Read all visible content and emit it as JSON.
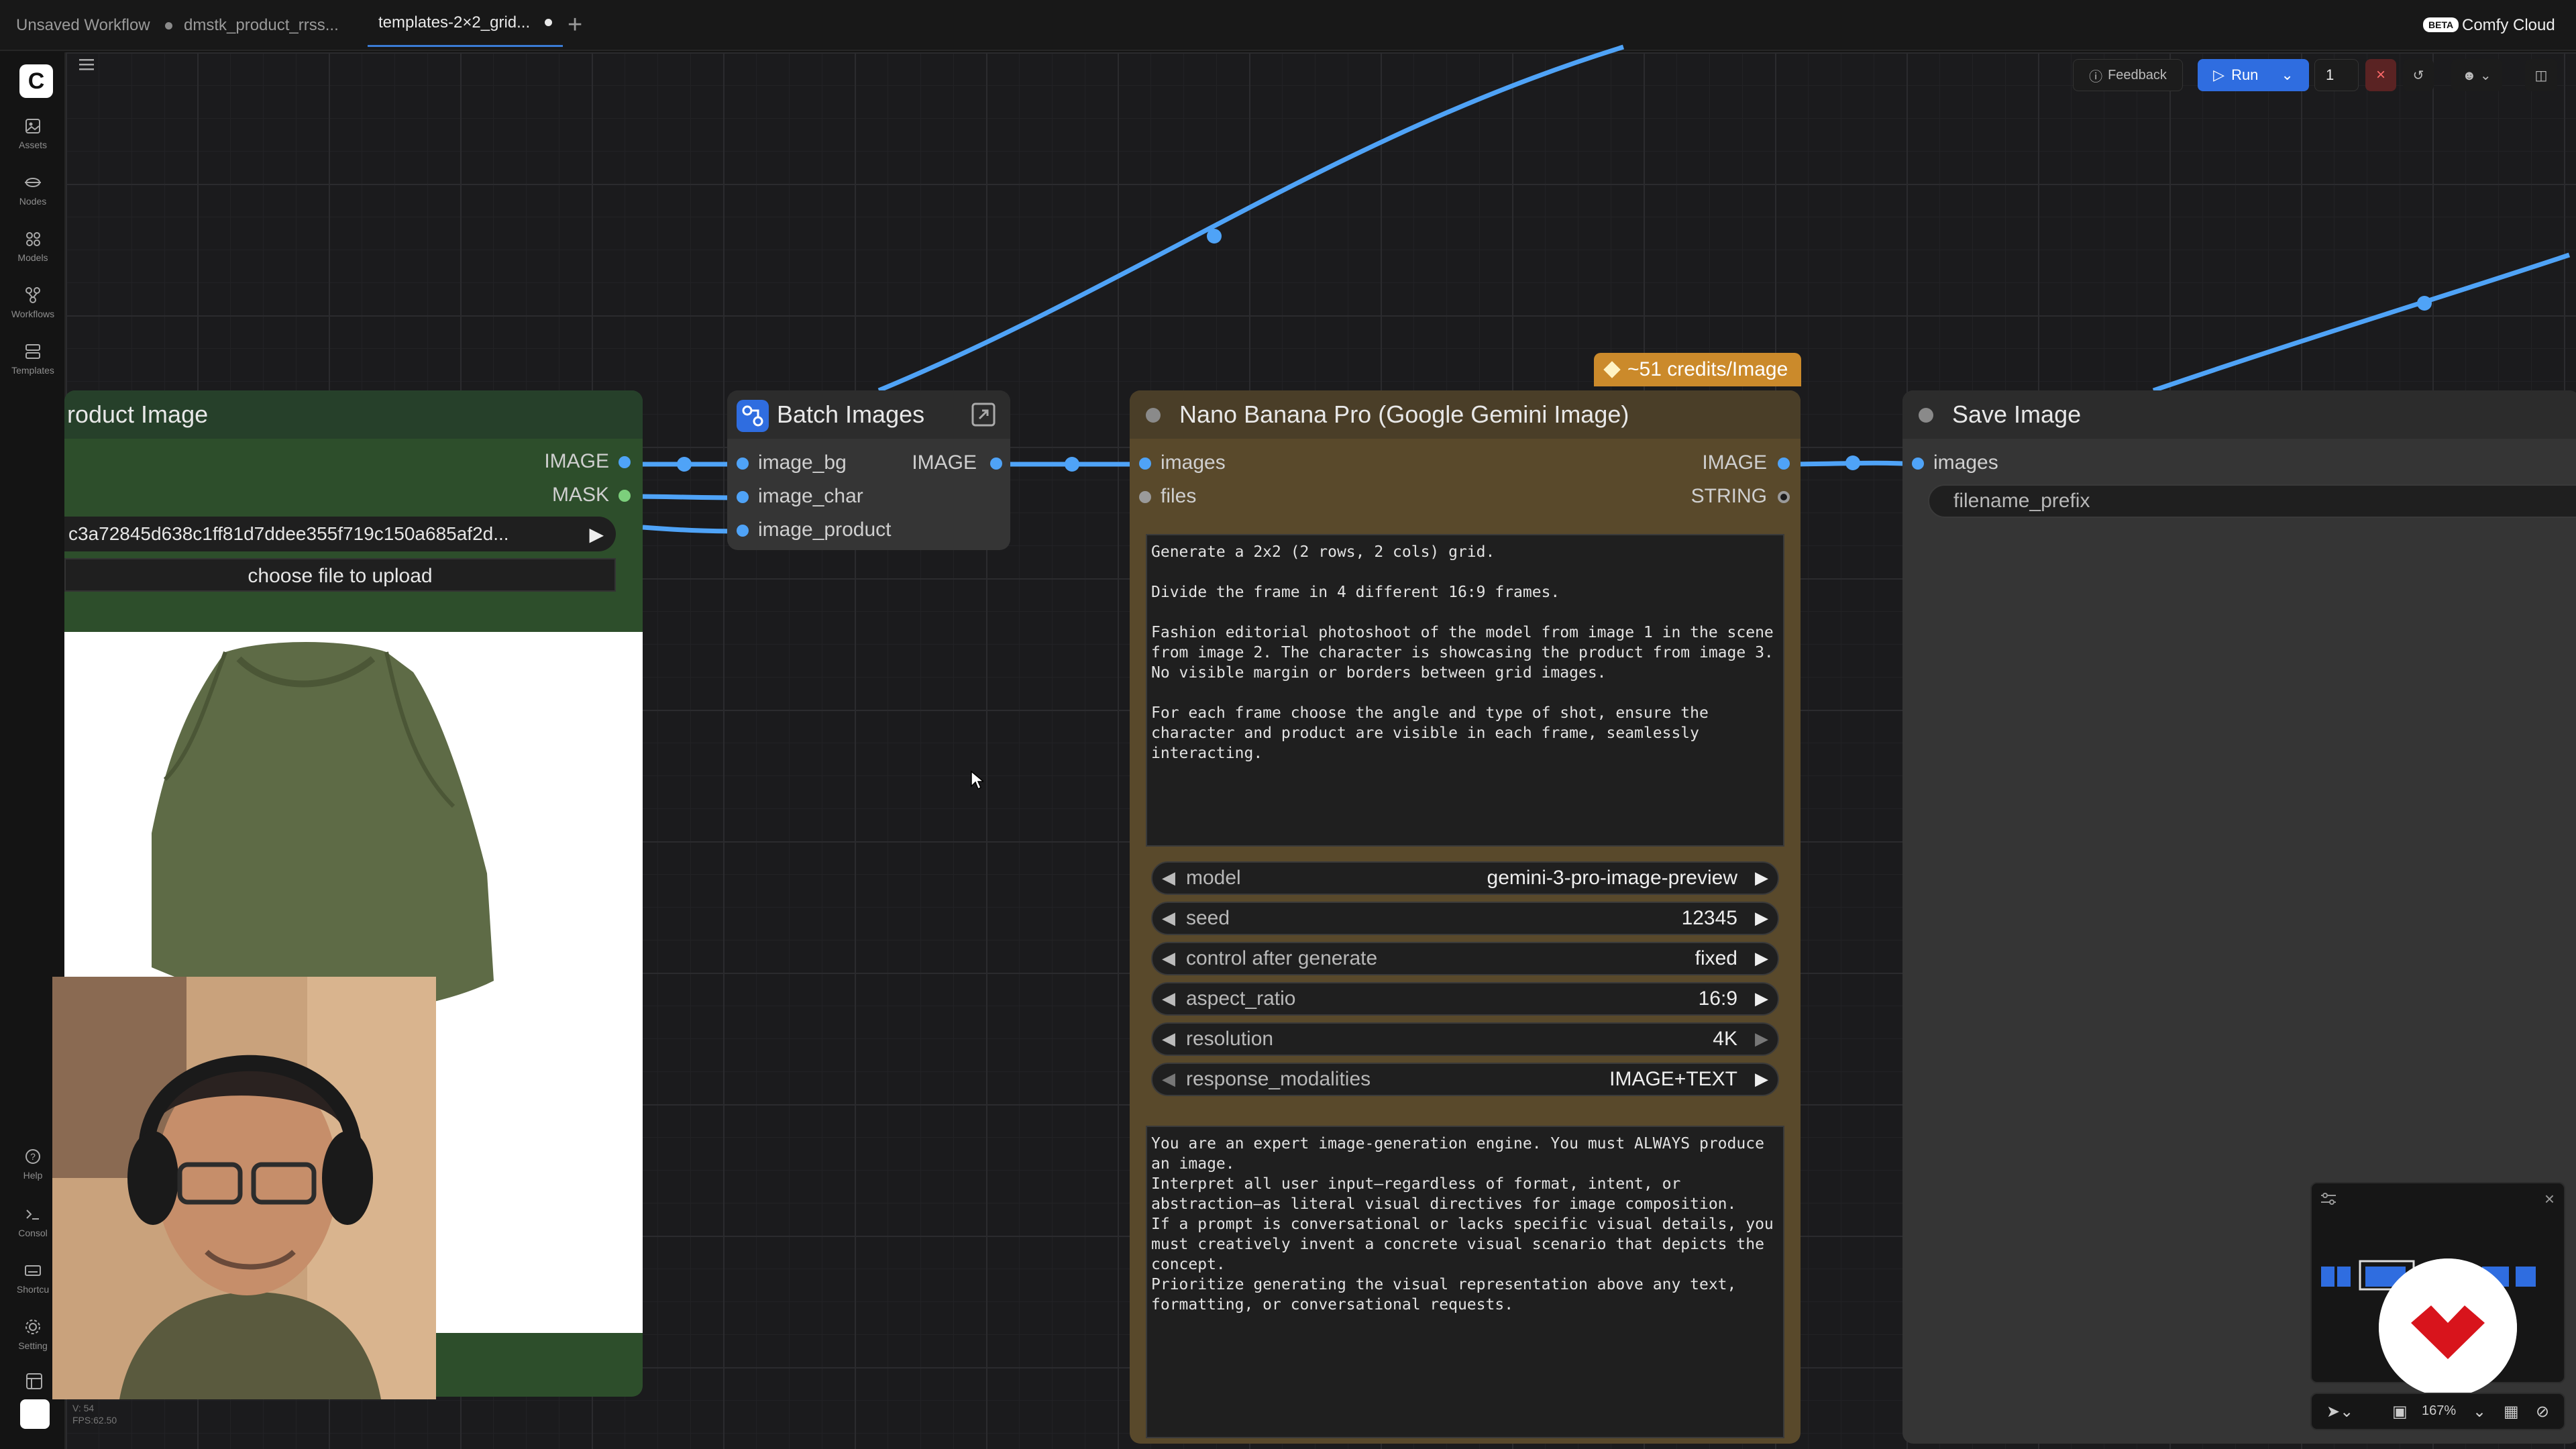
{
  "tabs": [
    {
      "label": "Unsaved Workflow",
      "modified": true,
      "active": false
    },
    {
      "label": "dmstk_product_rrss...",
      "modified": false,
      "active": false
    },
    {
      "label": "templates-2×2_grid...",
      "modified": true,
      "active": true
    }
  ],
  "header": {
    "cloud_badge": "BETA",
    "cloud_label": "Comfy Cloud"
  },
  "sidebar": {
    "items": [
      {
        "label": "Assets",
        "icon": "assets-icon"
      },
      {
        "label": "Nodes",
        "icon": "nodes-icon"
      },
      {
        "label": "Models",
        "icon": "models-icon"
      },
      {
        "label": "Workflows",
        "icon": "workflows-icon"
      },
      {
        "label": "Templates",
        "icon": "templates-icon"
      }
    ],
    "bottom_items": [
      {
        "label": "Help",
        "icon": "help-icon"
      },
      {
        "label": "Consol",
        "icon": "console-icon"
      },
      {
        "label": "Shortcu",
        "icon": "keyboard-icon"
      },
      {
        "label": "Setting",
        "icon": "gear-icon"
      }
    ],
    "version": "V: 54",
    "fps": "FPS:62.50"
  },
  "toolbar": {
    "feedback_label": "Feedback",
    "run_label": "Run",
    "run_count": "1"
  },
  "nodes": {
    "load_image": {
      "title": "roduct Image",
      "outputs": [
        "IMAGE",
        "MASK"
      ],
      "filename": "c3a72845d638c1ff81d7ddee355f719c150a685af2d...",
      "upload_label": "choose file to upload"
    },
    "batch_images": {
      "title": "Batch Images",
      "inputs": [
        "image_bg",
        "image_char",
        "image_product"
      ],
      "output": "IMAGE"
    },
    "nano_banana": {
      "title": "Nano Banana Pro (Google Gemini Image)",
      "credits": "~51 credits/Image",
      "inputs": [
        "images",
        "files"
      ],
      "outputs": [
        "IMAGE",
        "STRING"
      ],
      "prompt": "Generate a 2x2 (2 rows, 2 cols) grid.\n\nDivide the frame in 4 different 16:9 frames.\n\nFashion editorial photoshoot of the model from image 1 in the scene\nfrom image 2. The character is showcasing the product from image 3.\nNo visible margin or borders between grid images.\n\nFor each frame choose the angle and type of shot, ensure the\ncharacter and product are visible in each frame, seamlessly\ninteracting.",
      "widgets": [
        {
          "label": "model",
          "value": "gemini-3-pro-image-preview"
        },
        {
          "label": "seed",
          "value": "12345"
        },
        {
          "label": "control after generate",
          "value": "fixed"
        },
        {
          "label": "aspect_ratio",
          "value": "16:9"
        },
        {
          "label": "resolution",
          "value": "4K"
        },
        {
          "label": "response_modalities",
          "value": "IMAGE+TEXT"
        }
      ],
      "system_prompt": "You are an expert image-generation engine. You must ALWAYS produce\nan image.\nInterpret all user input—regardless of format, intent, or\nabstraction—as literal visual directives for image composition.\nIf a prompt is conversational or lacks specific visual details, you\nmust creatively invent a concrete visual scenario that depicts the\nconcept.\nPrioritize generating the visual representation above any text,\nformatting, or conversational requests."
    },
    "save_image": {
      "title": "Save Image",
      "input": "images",
      "filename_prefix": "filename_prefix"
    }
  },
  "canvas": {
    "zoom": "167%"
  },
  "colors": {
    "link": "#4fa3f7",
    "run_button": "#2f6de0",
    "load_node": "#2d4e2b",
    "banana_node": "#59492b",
    "credits_badge": "#cb8a2b",
    "brand_mark": "#d8141c"
  }
}
